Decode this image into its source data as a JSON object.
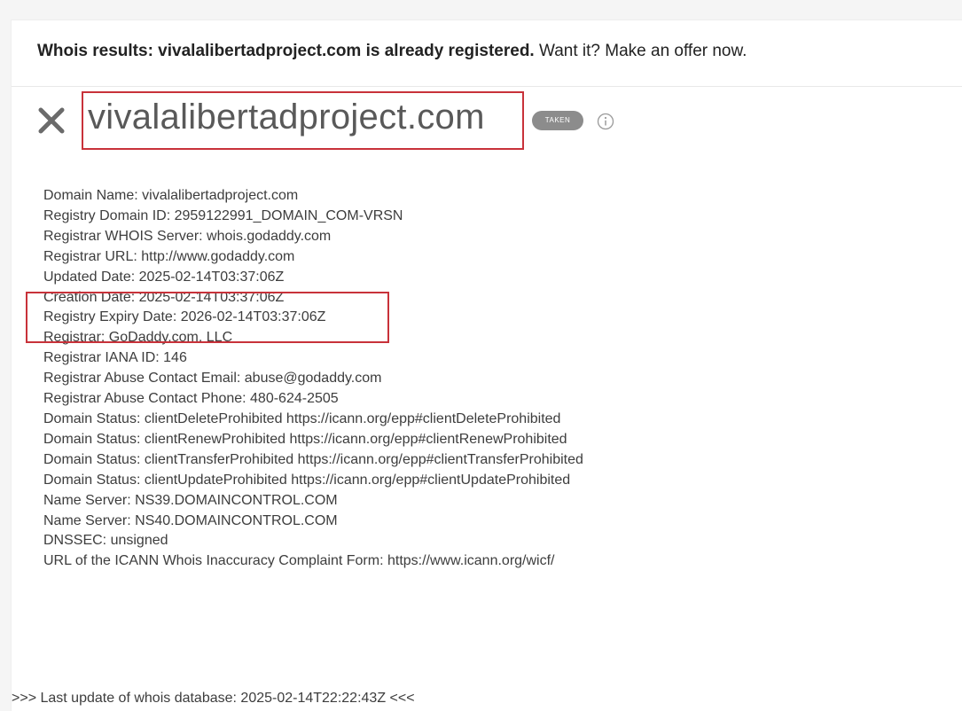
{
  "banner": {
    "bold_text": "Whois results: vivalalibertadproject.com is already registered.",
    "normal_text": " Want it? Make an offer now."
  },
  "header": {
    "domain": "vivalalibertadproject.com",
    "status_badge": "TAKEN",
    "close_icon": "close-icon",
    "info_icon": "info-icon"
  },
  "whois": {
    "lines": [
      "Domain Name: vivalalibertadproject.com",
      "Registry Domain ID: 2959122991_DOMAIN_COM-VRSN",
      "Registrar WHOIS Server: whois.godaddy.com",
      "Registrar URL: http://www.godaddy.com",
      "Updated Date: 2025-02-14T03:37:06Z",
      "Creation Date: 2025-02-14T03:37:06Z",
      "Registry Expiry Date: 2026-02-14T03:37:06Z",
      "Registrar: GoDaddy.com, LLC",
      "Registrar IANA ID: 146",
      "Registrar Abuse Contact Email: abuse@godaddy.com",
      "Registrar Abuse Contact Phone: 480-624-2505",
      "Domain Status: clientDeleteProhibited https://icann.org/epp#clientDeleteProhibited",
      "Domain Status: clientRenewProhibited https://icann.org/epp#clientRenewProhibited",
      "Domain Status: clientTransferProhibited https://icann.org/epp#clientTransferProhibited",
      "Domain Status: clientUpdateProhibited https://icann.org/epp#clientUpdateProhibited",
      "Name Server: NS39.DOMAINCONTROL.COM",
      "Name Server: NS40.DOMAINCONTROL.COM",
      "DNSSEC: unsigned",
      "URL of the ICANN Whois Inaccuracy Complaint Form: https://www.icann.org/wicf/"
    ],
    "last_update": ">>> Last update of whois database: 2025-02-14T22:22:43Z <<<"
  },
  "colors": {
    "highlight_box": "#c8323a",
    "badge_bg": "#8c8c8c",
    "domain_text": "#595959"
  }
}
